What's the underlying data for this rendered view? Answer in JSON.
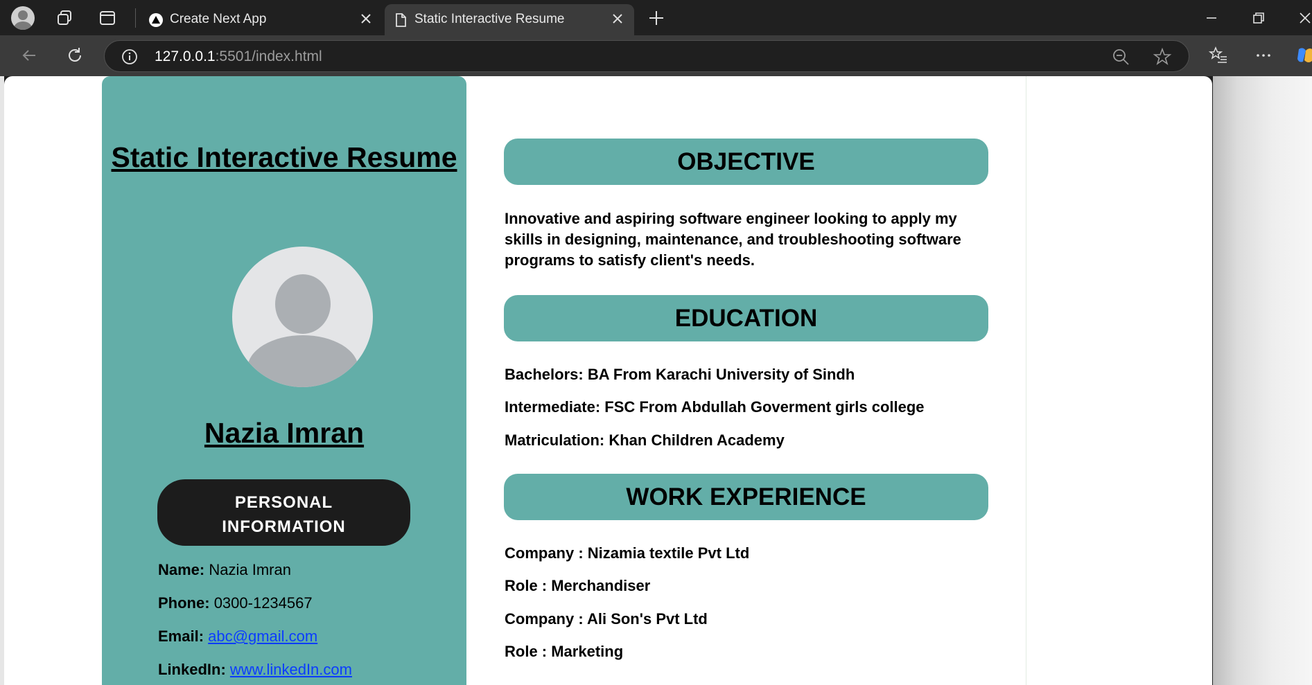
{
  "browser": {
    "tabs": [
      {
        "title": "Create Next App",
        "active": false
      },
      {
        "title": "Static Interactive Resume",
        "active": true
      }
    ],
    "address": {
      "host": "127.0.0.1",
      "rest": ":5501/index.html"
    }
  },
  "sidebar": {
    "site_title": "Static Interactive Resume",
    "name": "Nazia Imran",
    "personal_info_button": "PERSONAL INFORMATION",
    "info": {
      "name_label": "Name:",
      "name_value": "Nazia Imran",
      "phone_label": "Phone:",
      "phone_value": "0300-1234567",
      "email_label": "Email:",
      "email_value": "abc@gmail.com",
      "linkedin_label": "LinkedIn:",
      "linkedin_value": "www.linkedIn.com"
    }
  },
  "main": {
    "objective": {
      "heading": "OBJECTIVE",
      "text": "Innovative and aspiring software engineer looking to apply my skills in designing, maintenance, and troubleshooting software programs to satisfy client's needs."
    },
    "education": {
      "heading": "EDUCATION",
      "items": [
        "Bachelors: BA From Karachi University of Sindh",
        "Intermediate: FSC From Abdullah Goverment girls college",
        "Matriculation: Khan Children Academy"
      ]
    },
    "work": {
      "heading": "WORK EXPERIENCE",
      "items": [
        "Company : Nizamia textile Pvt Ltd",
        "Role : Merchandiser",
        "Company : Ali Son's Pvt Ltd",
        "Role : Marketing"
      ]
    }
  },
  "colors": {
    "accent": "#63aea8",
    "button_dark": "#1c1c1c",
    "link": "#0b3cff"
  }
}
